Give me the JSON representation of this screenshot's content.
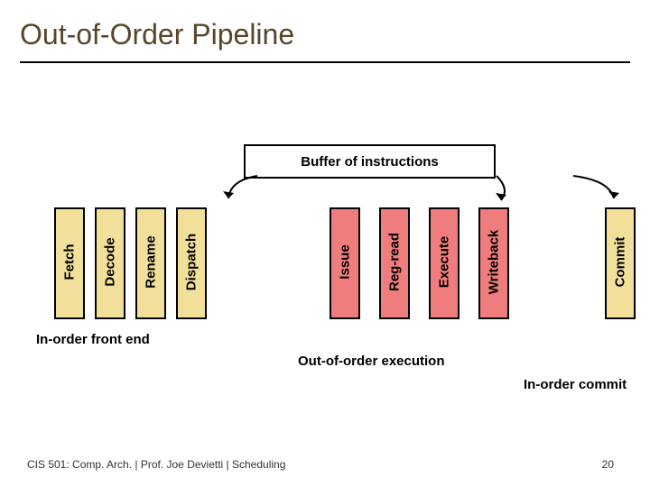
{
  "title": "Out-of-Order Pipeline",
  "buffer_label": "Buffer of instructions",
  "stages": {
    "fetch": "Fetch",
    "decode": "Decode",
    "rename": "Rename",
    "dispatch": "Dispatch",
    "issue": "Issue",
    "regread": "Reg-read",
    "execute": "Execute",
    "writeback": "Writeback",
    "commit": "Commit"
  },
  "group_labels": {
    "front": "In-order front end",
    "ooo": "Out-of-order execution",
    "commit": "In-order commit"
  },
  "footer": "CIS 501: Comp. Arch.   |   Prof. Joe Devietti   |   Scheduling",
  "page_number": "20"
}
